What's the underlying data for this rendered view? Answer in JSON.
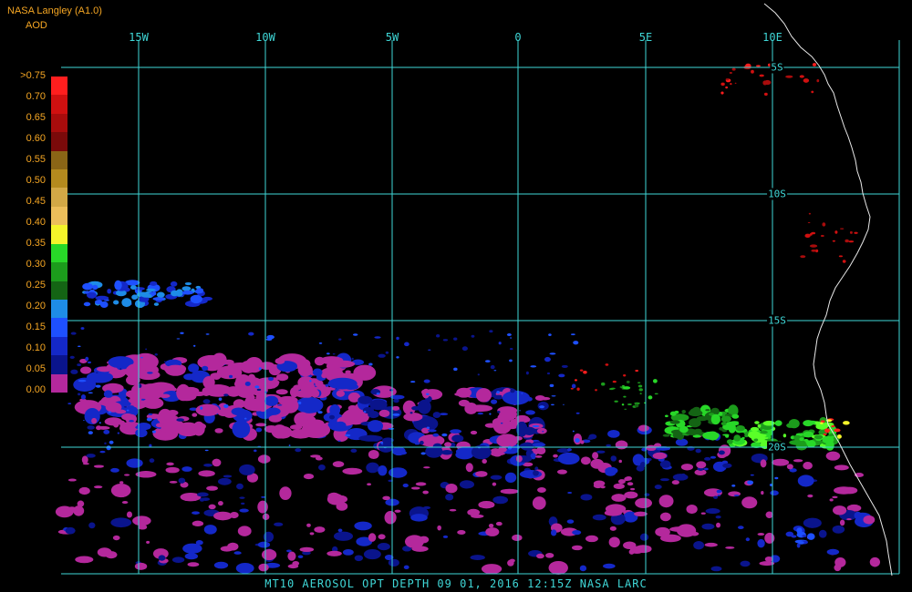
{
  "header": {
    "source": "NASA Langley (A1.0)",
    "product": "AOD"
  },
  "legend": {
    "labels": [
      ">0.75",
      "0.70",
      "0.65",
      "0.60",
      "0.55",
      "0.50",
      "0.45",
      "0.40",
      "0.35",
      "0.30",
      "0.25",
      "0.20",
      "0.15",
      "0.10",
      "0.05",
      "0.00"
    ],
    "colors": [
      "#ff1e1e",
      "#d01010",
      "#a80c0c",
      "#7a0a0a",
      "#8a6516",
      "#b48a1e",
      "#d2a846",
      "#ecbe5a",
      "#f4f42a",
      "#28d828",
      "#1c9c1c",
      "#146414",
      "#1e8ce6",
      "#1e50ff",
      "#1428c8",
      "#0a148c",
      "#b4289c"
    ]
  },
  "map": {
    "lon_labels": [
      "15W",
      "10W",
      "5W",
      "0",
      "5E",
      "10E"
    ],
    "lat_labels": [
      "5S",
      "10S",
      "15S",
      "20S"
    ]
  },
  "footer": {
    "text": "MT10  AEROSOL OPT DEPTH   09 01, 2016 12:15Z   NASA LARC"
  }
}
